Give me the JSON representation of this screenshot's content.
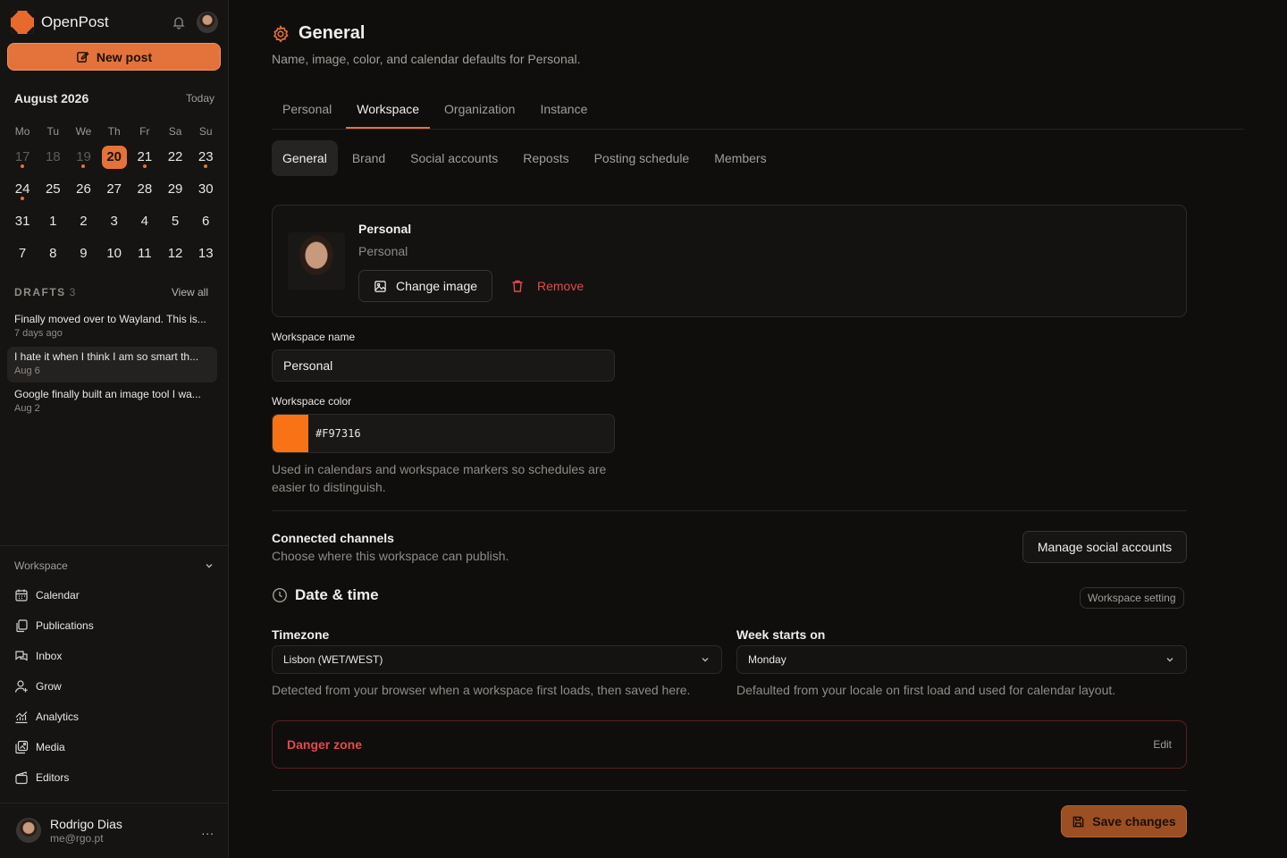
{
  "app": {
    "name": "OpenPost"
  },
  "sidebar": {
    "new_post": "New post",
    "calendar": {
      "month": "August 2026",
      "today": "Today",
      "dow": [
        "Mo",
        "Tu",
        "We",
        "Th",
        "Fr",
        "Sa",
        "Su"
      ],
      "weeks": [
        [
          "17",
          "18",
          "19",
          "20",
          "21",
          "22",
          "23"
        ],
        [
          "24",
          "25",
          "26",
          "27",
          "28",
          "29",
          "30"
        ],
        [
          "31",
          "1",
          "2",
          "3",
          "4",
          "5",
          "6"
        ],
        [
          "7",
          "8",
          "9",
          "10",
          "11",
          "12",
          "13"
        ]
      ],
      "selected": "20",
      "muted_days": [
        "17",
        "18",
        "19"
      ],
      "days_with_posts": [
        "17",
        "19",
        "21",
        "23",
        "24"
      ]
    },
    "drafts": {
      "title": "DRAFTS",
      "count": "3",
      "view_all": "View all",
      "items": [
        {
          "text": "Finally moved over to Wayland. This is...",
          "date": "7 days ago"
        },
        {
          "text": "I hate it when I think I am so smart th...",
          "date": "Aug 6"
        },
        {
          "text": "Google finally built an image tool I wa...",
          "date": "Aug 2"
        }
      ]
    },
    "workspace_label": "Workspace",
    "nav": [
      {
        "label": "Calendar",
        "icon": "calendar-icon"
      },
      {
        "label": "Publications",
        "icon": "publications-icon"
      },
      {
        "label": "Inbox",
        "icon": "inbox-icon"
      },
      {
        "label": "Grow",
        "icon": "grow-icon"
      },
      {
        "label": "Analytics",
        "icon": "analytics-icon"
      },
      {
        "label": "Media",
        "icon": "media-icon"
      },
      {
        "label": "Editors",
        "icon": "editors-icon"
      }
    ],
    "user": {
      "name": "Rodrigo Dias",
      "email": "me@rgo.pt",
      "menu": "..."
    }
  },
  "page": {
    "title": "General",
    "subtitle": "Name, image, color, and calendar defaults for Personal.",
    "tabs": [
      "Personal",
      "Workspace",
      "Organization",
      "Instance"
    ],
    "active_tab": "Workspace",
    "subtabs": [
      "General",
      "Brand",
      "Social accounts",
      "Reposts",
      "Posting schedule",
      "Members"
    ],
    "active_subtab": "General"
  },
  "profile_card": {
    "name": "Personal",
    "subtitle": "Personal",
    "change_image": "Change image",
    "remove": "Remove"
  },
  "form": {
    "workspace_name_label": "Workspace name",
    "workspace_name_value": "Personal",
    "workspace_color_label": "Workspace color",
    "workspace_color_value": "#F97316",
    "color_help": "Used in calendars and workspace markers so schedules are easier to distinguish."
  },
  "channels": {
    "title": "Connected channels",
    "subtitle": "Choose where this workspace can publish.",
    "manage": "Manage social accounts"
  },
  "datetime": {
    "title": "Date & time",
    "badge": "Workspace setting",
    "timezone_label": "Timezone",
    "timezone_value": "Lisbon (WET/WEST)",
    "timezone_help": "Detected from your browser when a workspace first loads, then saved here.",
    "week_label": "Week starts on",
    "week_value": "Monday",
    "week_help": "Defaulted from your locale on first load and used for calendar layout."
  },
  "danger": {
    "title": "Danger zone",
    "edit": "Edit"
  },
  "save": "Save changes",
  "colors": {
    "accent": "#E3733A",
    "workspace": "#F97316",
    "danger": "#E5484D",
    "background": "#0F0E0D"
  }
}
